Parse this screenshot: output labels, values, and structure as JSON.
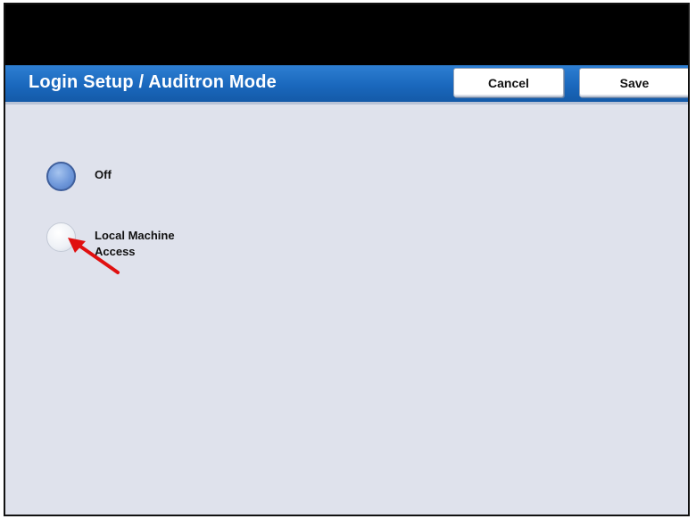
{
  "header": {
    "title": "Login Setup / Auditron Mode",
    "cancel_label": "Cancel",
    "save_label": "Save"
  },
  "options": [
    {
      "label": "Off",
      "selected": true
    },
    {
      "label": "Local Machine Access",
      "selected": false
    }
  ],
  "icons": {
    "annotation": "red-arrow-icon"
  },
  "colors": {
    "header_blue": "#1a68bd",
    "background": "#dfe2ec",
    "annotation_red": "#e01010"
  }
}
